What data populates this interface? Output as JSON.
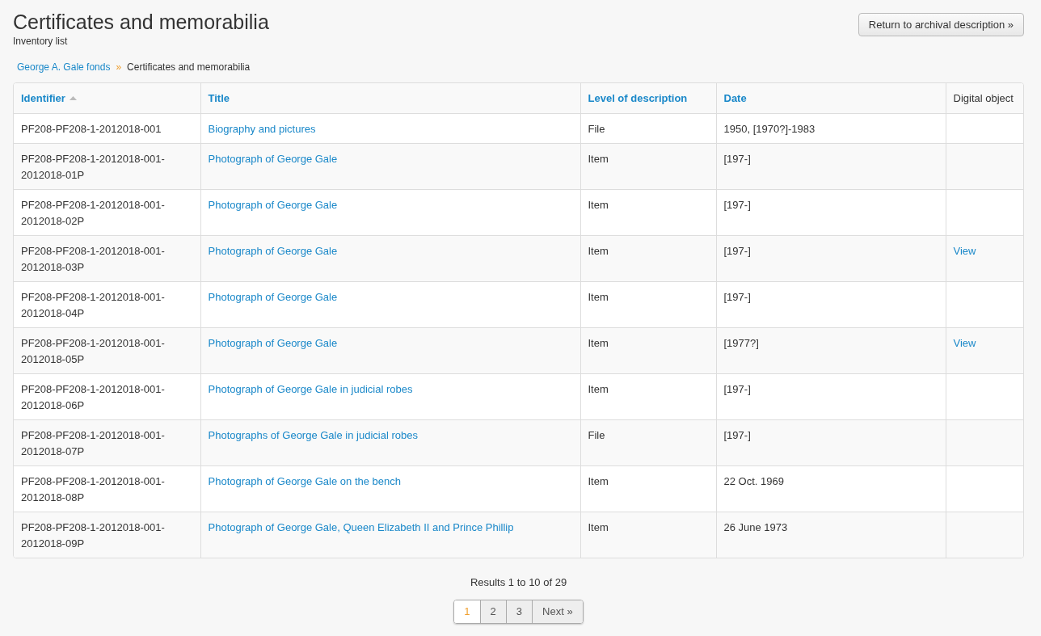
{
  "page": {
    "title": "Certificates and memorabilia",
    "subtitle": "Inventory list"
  },
  "return_button": "Return to archival description »",
  "breadcrumb": [
    {
      "label": "George A. Gale fonds",
      "kind": "link"
    },
    {
      "label": "»",
      "kind": "separator"
    },
    {
      "label": "Certificates and memorabilia",
      "kind": "current"
    }
  ],
  "table": {
    "columns": [
      {
        "label": "Identifier",
        "kind": "sortable",
        "sorted": true
      },
      {
        "label": "Title",
        "kind": "sortable",
        "sorted": false
      },
      {
        "label": "Level of description",
        "kind": "sortable",
        "sorted": false
      },
      {
        "label": "Date",
        "kind": "sortable",
        "sorted": false
      },
      {
        "label": "Digital object",
        "kind": "plain"
      }
    ],
    "rows": [
      {
        "identifier": "PF208-PF208-1-2012018-001",
        "title": "Biography and pictures",
        "level": "File",
        "date": "1950, [1970?]-1983"
      },
      {
        "identifier": "PF208-PF208-1-2012018-001-2012018-01P",
        "title": "Photograph of George Gale",
        "level": "Item",
        "date": "[197-]"
      },
      {
        "identifier": "PF208-PF208-1-2012018-001-2012018-02P",
        "title": "Photograph of George Gale",
        "level": "Item",
        "date": "[197-]"
      },
      {
        "identifier": "PF208-PF208-1-2012018-001-2012018-03P",
        "title": "Photograph of George Gale",
        "level": "Item",
        "date": "[197-]",
        "digital_object": "View"
      },
      {
        "identifier": "PF208-PF208-1-2012018-001-2012018-04P",
        "title": "Photograph of George Gale",
        "level": "Item",
        "date": "[197-]"
      },
      {
        "identifier": "PF208-PF208-1-2012018-001-2012018-05P",
        "title": "Photograph of George Gale",
        "level": "Item",
        "date": "[1977?]",
        "digital_object": "View"
      },
      {
        "identifier": "PF208-PF208-1-2012018-001-2012018-06P",
        "title": "Photograph of George Gale in judicial robes",
        "level": "Item",
        "date": "[197-]"
      },
      {
        "identifier": "PF208-PF208-1-2012018-001-2012018-07P",
        "title": "Photographs of George Gale in judicial robes",
        "level": "File",
        "date": "[197-]"
      },
      {
        "identifier": "PF208-PF208-1-2012018-001-2012018-08P",
        "title": "Photograph of George Gale on the bench",
        "level": "Item",
        "date": "22 Oct. 1969"
      },
      {
        "identifier": "PF208-PF208-1-2012018-001-2012018-09P",
        "title": "Photograph of George Gale, Queen Elizabeth II and Prince Phillip",
        "level": "Item",
        "date": "26 June 1973"
      }
    ]
  },
  "results": "Results 1 to 10 of 29",
  "pagination": [
    {
      "label": "1",
      "selected": true
    },
    {
      "label": "2",
      "selected": false
    },
    {
      "label": "3",
      "selected": false
    },
    {
      "label": "Next »",
      "selected": false
    }
  ]
}
